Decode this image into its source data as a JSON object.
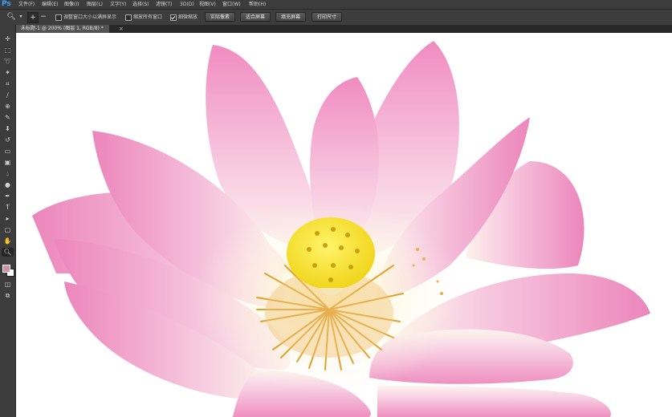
{
  "app": {
    "logo": "Ps"
  },
  "menus": [
    "文件(F)",
    "编辑(E)",
    "图像(I)",
    "图层(L)",
    "文字(Y)",
    "选择(S)",
    "滤镜(T)",
    "3D(D)",
    "视图(V)",
    "窗口(W)",
    "帮助(H)"
  ],
  "options": {
    "tool_icon": "zoom-icon",
    "zoom_in_icon": "zoom-in-icon",
    "zoom_out_icon": "zoom-out-icon",
    "resize_windows_label": "调整窗口大小以满屏显示",
    "resize_windows_checked": false,
    "zoom_all_label": "缩放所有窗口",
    "zoom_all_checked": false,
    "scrubby_zoom_label": "细微缩放",
    "scrubby_zoom_checked": true,
    "actual_pixels_label": "实际像素",
    "fit_screen_label": "适合屏幕",
    "fill_screen_label": "填充屏幕",
    "print_size_label": "打印尺寸"
  },
  "document": {
    "tab_title": "未标题-1 @ 200% (图层 1, RGB/8) *",
    "close_glyph": "×"
  },
  "tools": [
    "move-icon",
    "marquee-icon",
    "lasso-icon",
    "quick-select-icon",
    "crop-icon",
    "eyedropper-icon",
    "healing-icon",
    "brush-icon",
    "stamp-icon",
    "history-brush-icon",
    "eraser-icon",
    "gradient-icon",
    "blur-icon",
    "dodge-icon",
    "pen-icon",
    "type-icon",
    "path-select-icon",
    "shape-icon",
    "hand-icon",
    "zoom-icon"
  ],
  "colors": {
    "foreground": "#cf8fa6",
    "background": "#ffffff",
    "accent": "#32a2ff"
  }
}
